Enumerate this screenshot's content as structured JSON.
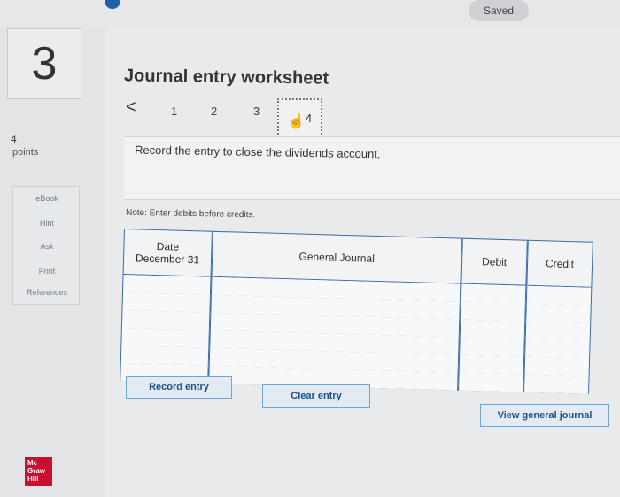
{
  "status": {
    "saved_label": "Saved"
  },
  "question": {
    "number": "3",
    "points_value": "4",
    "points_label": "points"
  },
  "sidebar": {
    "items": [
      {
        "label": "eBook"
      },
      {
        "label": "Hint"
      },
      {
        "label": "Ask"
      },
      {
        "label": "Print"
      },
      {
        "label": "References"
      }
    ]
  },
  "logo": {
    "text": "Mc Graw Hill"
  },
  "worksheet": {
    "title": "Journal entry worksheet",
    "prev_symbol": "<",
    "pages": [
      "1",
      "2",
      "3",
      "4"
    ],
    "active_page": "4",
    "instruction": "Record the entry to close the dividends account.",
    "note": "Note: Enter debits before credits."
  },
  "journal": {
    "headers": {
      "date": "Date",
      "account": "General Journal",
      "debit": "Debit",
      "credit": "Credit"
    },
    "first_date": "December 31",
    "rows": 6
  },
  "buttons": {
    "record": "Record entry",
    "clear": "Clear entry",
    "view_journal": "View general journal"
  }
}
